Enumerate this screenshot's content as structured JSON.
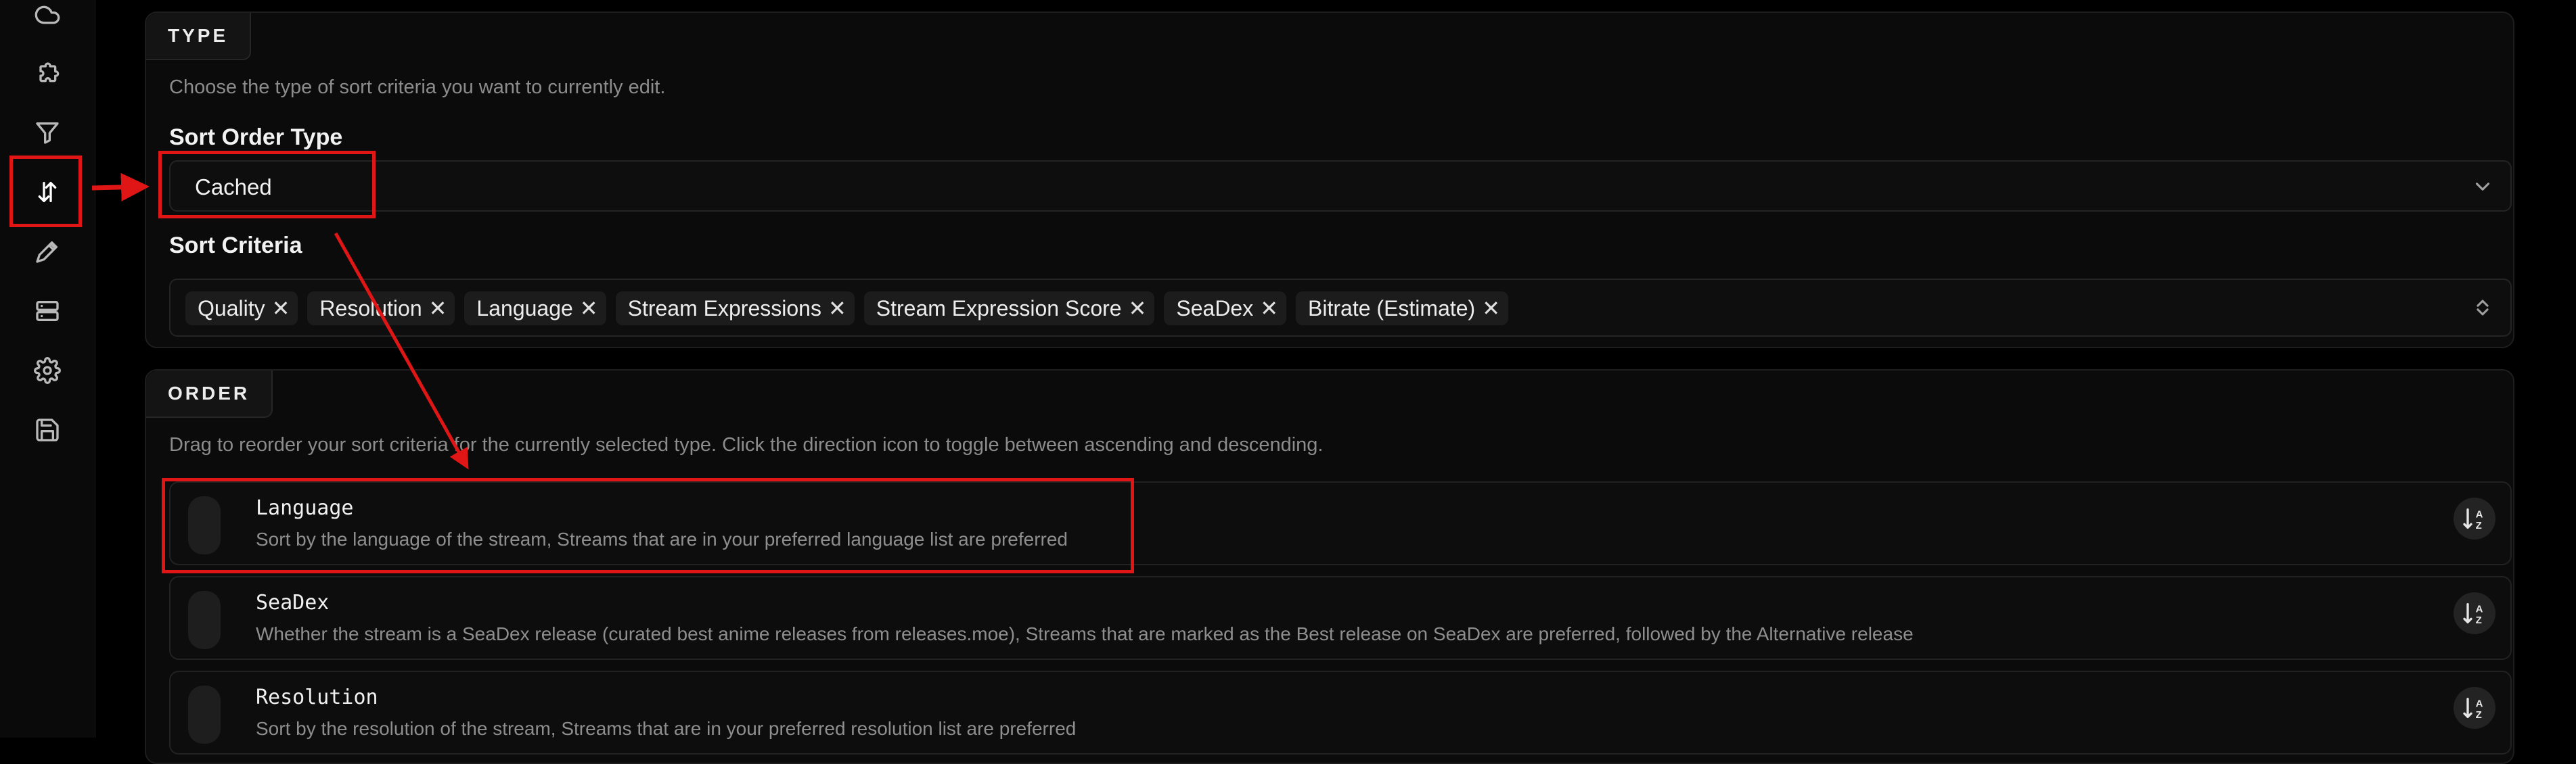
{
  "sidebar": {
    "items": [
      {
        "name": "cloud-icon"
      },
      {
        "name": "puzzle-icon"
      },
      {
        "name": "filter-icon"
      },
      {
        "name": "sort-icon",
        "active": true
      },
      {
        "name": "pen-icon"
      },
      {
        "name": "server-icon"
      },
      {
        "name": "gear-icon"
      },
      {
        "name": "save-icon"
      }
    ]
  },
  "type_section": {
    "tab": "TYPE",
    "description": "Choose the type of sort criteria you want to currently edit.",
    "sort_order_type_label": "Sort Order Type",
    "sort_order_type_value": "Cached",
    "sort_criteria_label": "Sort Criteria",
    "chips": [
      "Quality",
      "Resolution",
      "Language",
      "Stream Expressions",
      "Stream Expression Score",
      "SeaDex",
      "Bitrate (Estimate)"
    ],
    "chip_remove_glyph": "✕"
  },
  "order_section": {
    "tab": "ORDER",
    "description": "Drag to reorder your sort criteria for the currently selected type. Click the direction icon to toggle between ascending and descending.",
    "rows": [
      {
        "title": "Language",
        "description": "Sort by the language of the stream, Streams that are in your preferred language list are preferred"
      },
      {
        "title": "SeaDex",
        "description": "Whether the stream is a SeaDex release (curated best anime releases from releases.moe), Streams that are marked as the Best release on SeaDex are preferred, followed by the Alternative release"
      },
      {
        "title": "Resolution",
        "description": "Sort by the resolution of the stream, Streams that are in your preferred resolution list are preferred"
      }
    ]
  },
  "colors": {
    "background": "#000000",
    "card": "#0b0b0b",
    "annotation": "#e01515",
    "muted_text": "#8c8c8c"
  }
}
